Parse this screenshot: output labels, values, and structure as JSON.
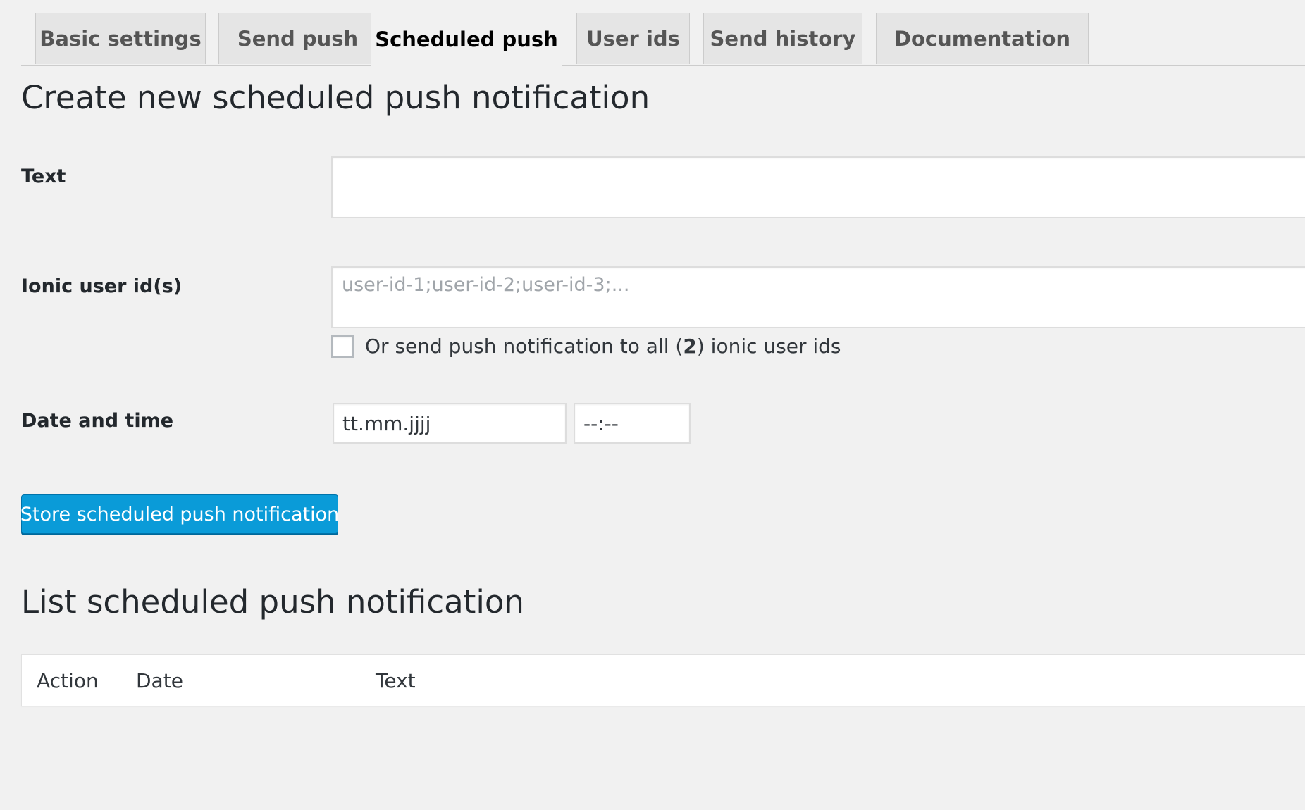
{
  "tabs": [
    {
      "label": "Basic settings",
      "active": false
    },
    {
      "label": "Send push",
      "active": false
    },
    {
      "label": "Scheduled push",
      "active": true
    },
    {
      "label": "User ids",
      "active": false
    },
    {
      "label": "Send history",
      "active": false
    },
    {
      "label": "Documentation",
      "active": false
    }
  ],
  "create_section": {
    "title": "Create new scheduled push notification",
    "text_field": {
      "label": "Text",
      "value": "",
      "placeholder": ""
    },
    "user_ids_field": {
      "label": "Ionic user id(s)",
      "value": "",
      "placeholder": "user-id-1;user-id-2;user-id-3;..."
    },
    "send_to_all": {
      "label_prefix": "Or send push notification to all (",
      "count": "2",
      "label_suffix": ") ionic user ids",
      "checked": false
    },
    "datetime_field": {
      "label": "Date and time",
      "date_value": "tt.mm.jjjj",
      "time_value": "--:--"
    },
    "submit_button": "Store scheduled push notification"
  },
  "list_section": {
    "title": "List scheduled push notification",
    "columns": [
      "Action",
      "Date",
      "Text"
    ],
    "rows": []
  },
  "colors": {
    "background": "#f1f1f1",
    "primary_button": "#0a9bd8",
    "text": "#23282d"
  }
}
